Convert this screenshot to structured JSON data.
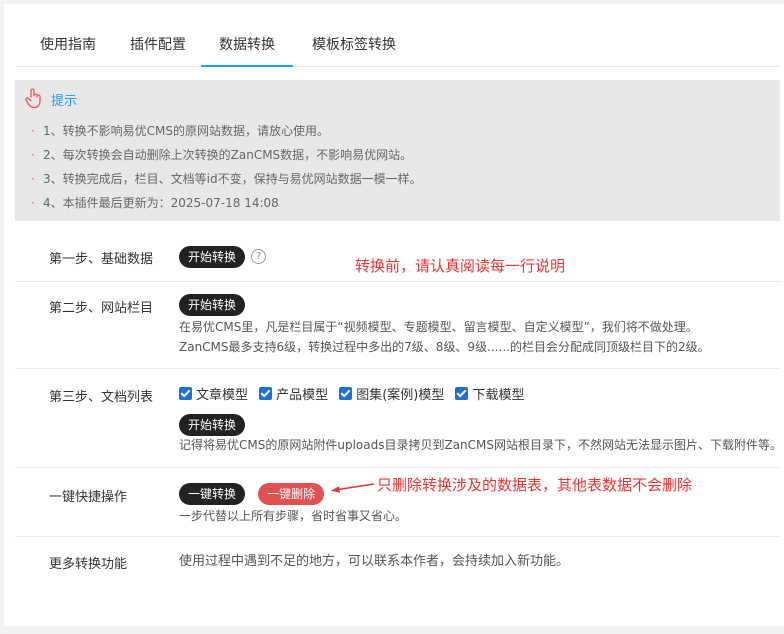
{
  "tabs": [
    {
      "label": "使用指南"
    },
    {
      "label": "插件配置"
    },
    {
      "label": "数据转换"
    },
    {
      "label": "模板标签转换"
    }
  ],
  "tip": {
    "title": "提示",
    "items": [
      "1、转换不影响易优CMS的原网站数据，请放心使用。",
      "2、每次转换会自动删除上次转换的ZanCMS数据，不影响易优网站。",
      "3、转换完成后，栏目、文档等id不变，保持与易优网站数据一模一样。",
      "4、本插件最后更新为：2025-07-18 14:08"
    ]
  },
  "step1": {
    "label": "第一步、基础数据",
    "button": "开始转换",
    "help": "?"
  },
  "step2": {
    "label": "第二步、网站栏目",
    "button": "开始转换",
    "desc1": "在易优CMS里，凡是栏目属于“视频模型、专题模型、留言模型、自定义模型”，我们将不做处理。",
    "desc2": "ZanCMS最多支持6级，转换过程中多出的7级、8级、9级......的栏目会分配成同顶级栏目下的2级。"
  },
  "step3": {
    "label": "第三步、文档列表",
    "checks": [
      "文章模型",
      "产品模型",
      "图集(案例)模型",
      "下载模型"
    ],
    "button": "开始转换",
    "desc": "记得将易优CMS的原网站附件uploads目录拷贝到ZanCMS网站根目录下，不然网站无法显示图片、下载附件等。"
  },
  "quick": {
    "label": "一键快捷操作",
    "convert": "一键转换",
    "delete": "一键删除",
    "desc": "一步代替以上所有步骤，省时省事又省心。"
  },
  "more": {
    "label": "更多转换功能",
    "desc": "使用过程中遇到不足的地方，可以联系本作者，会持续加入新功能。"
  },
  "annotations": {
    "read_note": "转换前，请认真阅读每一行说明",
    "delete_note": "只删除转换涉及的数据表，其他表数据不会删除"
  },
  "colors": {
    "accent": "#1e9fff",
    "annotation": "#ee3333",
    "delete_button": "#e25050",
    "dark_button": "#222222"
  }
}
